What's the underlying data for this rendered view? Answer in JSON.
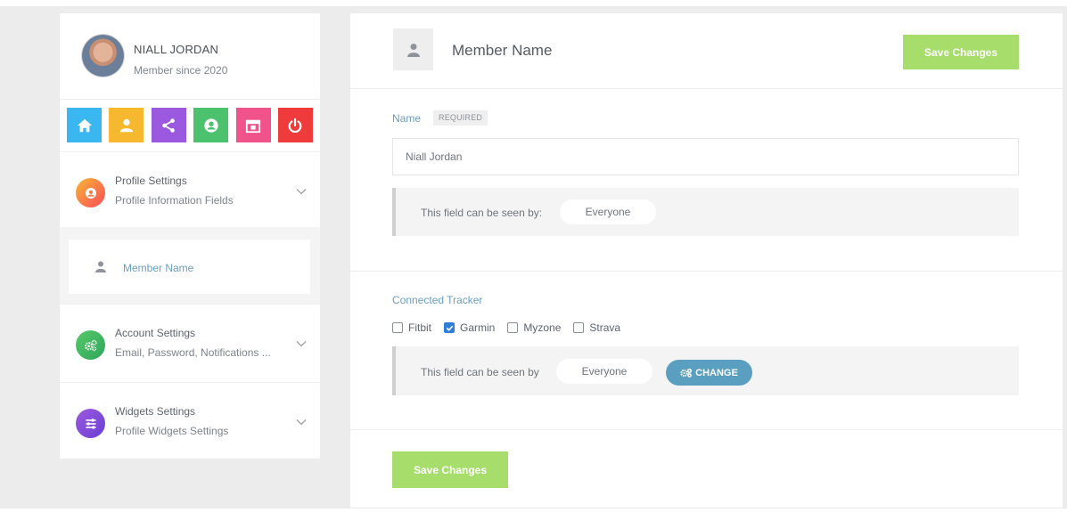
{
  "sidebar": {
    "profile": {
      "name": "NIALL JORDAN",
      "member_since": "Member since 2020"
    },
    "icon_buttons": [
      {
        "icon": "home-icon",
        "color": "#3ab7f0"
      },
      {
        "icon": "user-icon",
        "color": "#f5b82e"
      },
      {
        "icon": "share-icon",
        "color": "#9b59e0"
      },
      {
        "icon": "user-circle-icon",
        "color": "#4cc26f"
      },
      {
        "icon": "calendar-icon",
        "color": "#f0538a"
      },
      {
        "icon": "power-icon",
        "color": "#ef3b3b"
      }
    ],
    "sections": [
      {
        "title": "Profile Settings",
        "subtitle": "Profile Information Fields",
        "icon": "profile-circle-icon",
        "expanded": true
      },
      {
        "title": "Account Settings",
        "subtitle": "Email, Password, Notifications ...",
        "icon": "gears-icon",
        "expanded": false
      },
      {
        "title": "Widgets Settings",
        "subtitle": "Profile Widgets Settings",
        "icon": "sliders-icon",
        "expanded": false
      }
    ],
    "submenu": {
      "label": "Member Name",
      "icon": "user-icon"
    }
  },
  "main": {
    "header": {
      "title": "Member Name",
      "icon": "user-icon",
      "save_label": "Save Changes"
    },
    "name_field": {
      "label": "Name",
      "badge": "REQUIRED",
      "value": "Niall Jordan",
      "visibility_text": "This field can be seen by:",
      "visibility_value": "Everyone"
    },
    "tracker_field": {
      "label": "Connected Tracker",
      "options": [
        {
          "label": "Fitbit",
          "checked": false
        },
        {
          "label": "Garmin",
          "checked": true
        },
        {
          "label": "Myzone",
          "checked": false
        },
        {
          "label": "Strava",
          "checked": false
        }
      ],
      "visibility_text": "This field can be seen by",
      "visibility_value": "Everyone",
      "change_label": "CHANGE"
    },
    "footer": {
      "save_label": "Save Changes"
    }
  },
  "colors": {
    "accent_green": "#a6dd6b",
    "link_blue": "#6e9dbd",
    "change_blue": "#5a9fbf",
    "checkbox_blue": "#2f7fd6"
  }
}
